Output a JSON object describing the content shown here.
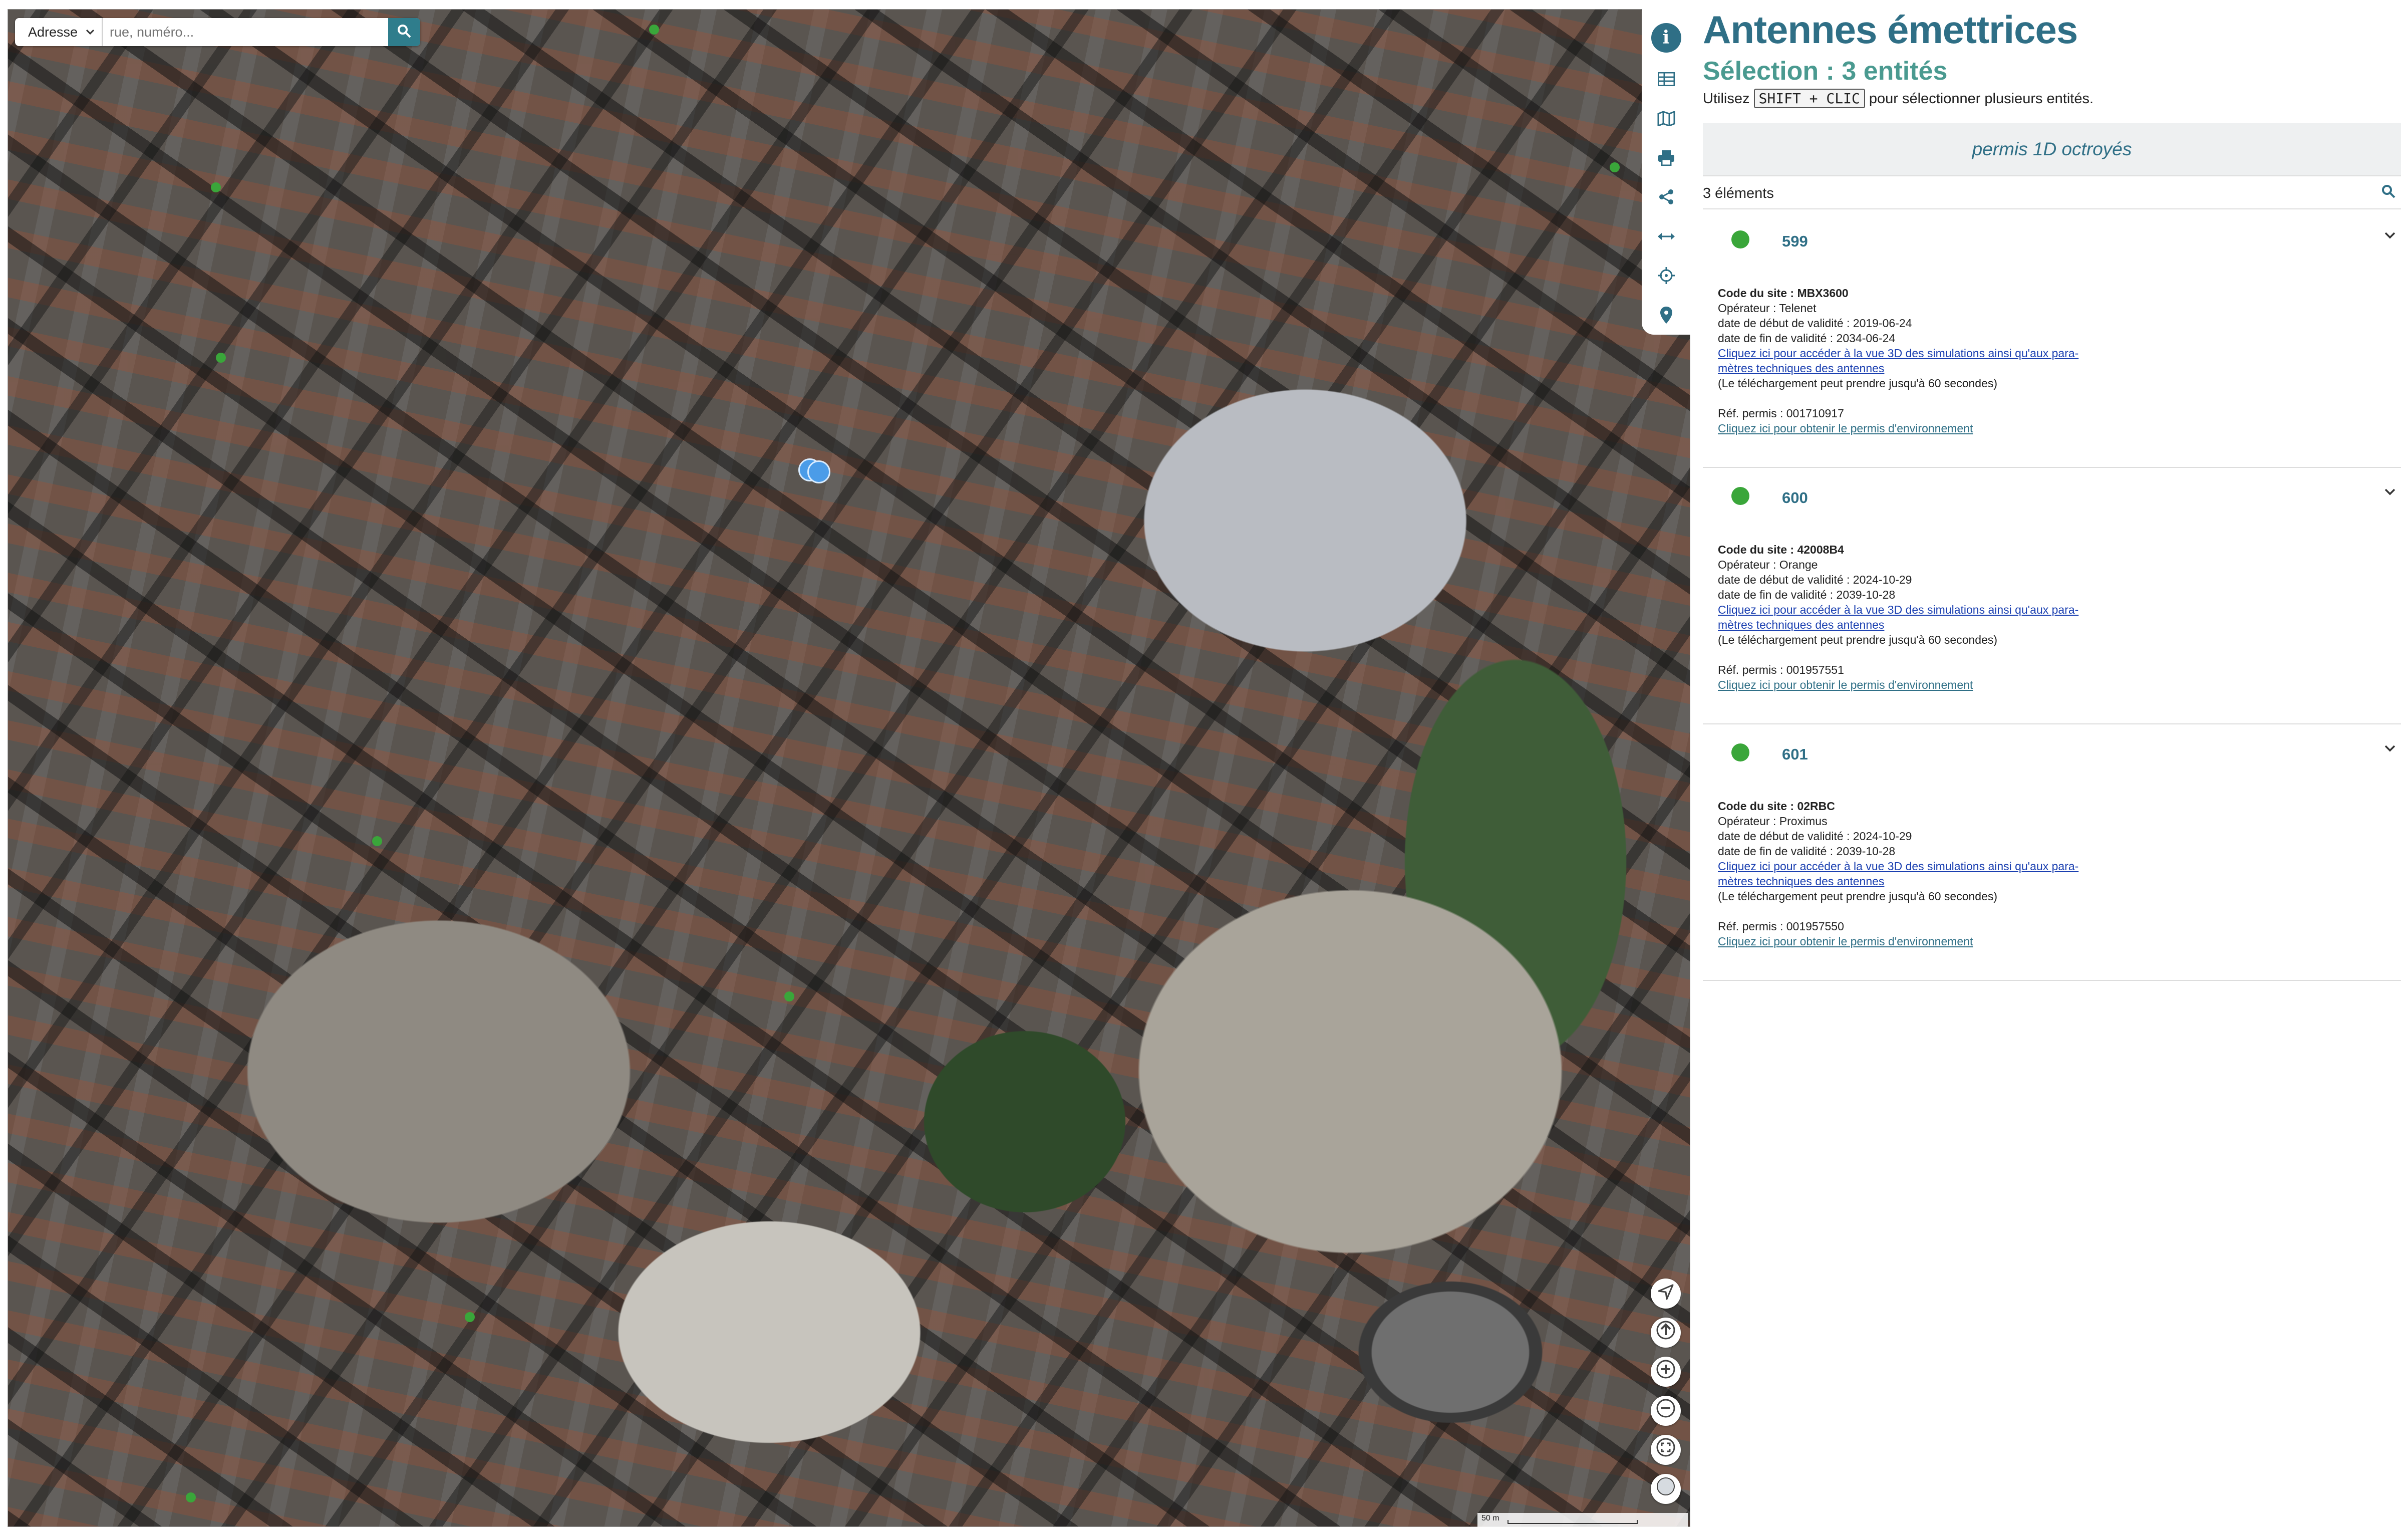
{
  "search": {
    "mode_label": "Adresse",
    "placeholder": "rue, numéro..."
  },
  "panel": {
    "title": "Antennes émettrices",
    "subtitle": "Sélection : 3 entités",
    "hint_prefix": "Utilisez",
    "hint_key": "SHIFT + CLIC",
    "hint_suffix": "pour sélectionner plusieurs entités.",
    "group_title": "permis 1D octroyés",
    "count_label": "3 éléments",
    "entities": [
      {
        "name": "599",
        "code": "Code du site : MBX3600",
        "operator": "Opérateur : Telenet",
        "start": "date de début de validité : 2019-06-24",
        "end": "date de fin de validité : 2034-06-24",
        "link3d_line1": "Cliquez ici pour accéder à la vue 3D des simulations ainsi qu'aux para-",
        "link3d_line2": "mètres techniques des antennes",
        "download_note": "(Le téléchargement peut prendre jusqu'à 60 secondes)",
        "permit_ref": "Réf. permis : 001710917",
        "permit_link": "Cliquez ici pour obtenir le permis d'environnement"
      },
      {
        "name": "600",
        "code": "Code du site : 42008B4",
        "operator": "Opérateur : Orange",
        "start": "date de début de validité : 2024-10-29",
        "end": "date de fin de validité : 2039-10-28",
        "link3d_line1": "Cliquez ici pour accéder à la vue 3D des simulations ainsi qu'aux para-",
        "link3d_line2": "mètres techniques des antennes",
        "download_note": "(Le téléchargement peut prendre jusqu'à 60 secondes)",
        "permit_ref": "Réf. permis : 001957551",
        "permit_link": "Cliquez ici pour obtenir le permis d'environnement"
      },
      {
        "name": "601",
        "code": "Code du site : 02RBC",
        "operator": "Opérateur : Proximus",
        "start": "date de début de validité : 2024-10-29",
        "end": "date de fin de validité : 2039-10-28",
        "link3d_line1": "Cliquez ici pour accéder à la vue 3D des simulations ainsi qu'aux para-",
        "link3d_line2": "mètres techniques des antennes",
        "download_note": "(Le téléchargement peut prendre jusqu'à 60 secondes)",
        "permit_ref": "Réf. permis : 001957550",
        "permit_link": "Cliquez ici pour obtenir le permis d'environnement"
      }
    ]
  },
  "map": {
    "scale_label": "50 m"
  },
  "icons": {
    "toolbar": [
      "info-icon",
      "table-icon",
      "map-icon",
      "print-icon",
      "share-icon",
      "measure-icon",
      "crosshair-icon",
      "pin-icon"
    ],
    "controls": [
      "navigate-icon",
      "north-arrow-icon",
      "zoom-in-icon",
      "zoom-out-icon",
      "fullscreen-icon",
      "basemap-icon"
    ]
  },
  "colors": {
    "accent": "#2f6f86",
    "accent_green": "#4a9a90",
    "status_green": "#3aa63a",
    "link_blue": "#1a3fb0"
  }
}
